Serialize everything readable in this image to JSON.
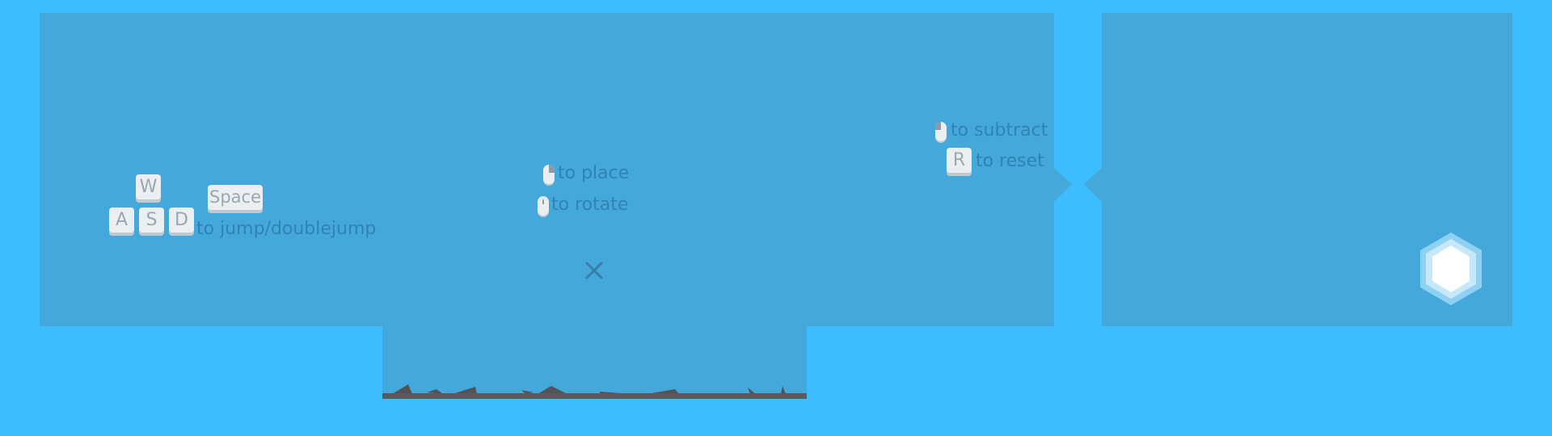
{
  "controls": {
    "move": {
      "keys": [
        "W",
        "A",
        "S",
        "D"
      ],
      "jump_key": "Space",
      "caption": "to jump/doublejump"
    },
    "mouse": {
      "place_caption": "to place",
      "rotate_caption": "to rotate"
    },
    "edit": {
      "subtract_caption": "to subtract",
      "reset_key": "R",
      "reset_caption": "to reset"
    }
  },
  "colors": {
    "sky": "#3dbdfd",
    "room": "#44a8da",
    "key": "#eceff1",
    "hint_text": "#2f83b5",
    "ground": "#5a5a5a",
    "goal": "#ffffff"
  },
  "icons": [
    "left-mouse-icon",
    "mouse-wheel-icon",
    "right-mouse-icon",
    "close-icon",
    "hexagon-goal-icon"
  ]
}
